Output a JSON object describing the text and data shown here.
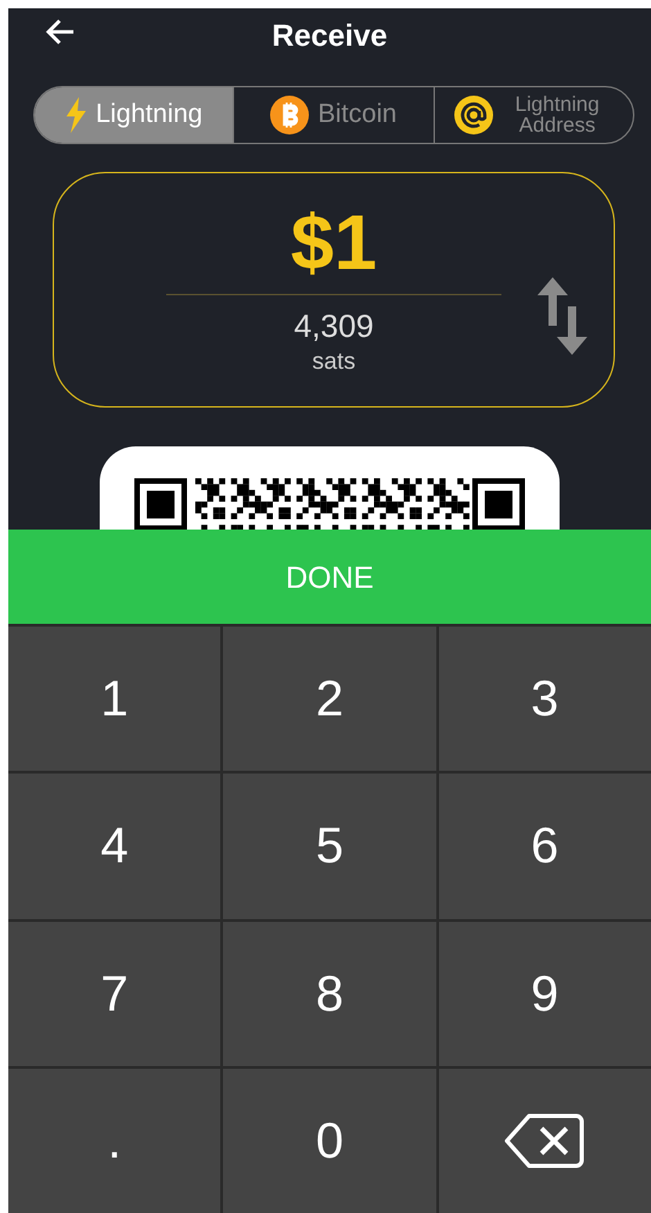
{
  "header": {
    "title": "Receive"
  },
  "tabs": [
    {
      "label": "Lightning",
      "kind": "bolt",
      "selected": true
    },
    {
      "label": "Bitcoin",
      "kind": "bitcoin",
      "selected": false
    },
    {
      "label": "Lightning Address",
      "kind": "at",
      "selected": false
    }
  ],
  "amount": {
    "primary": "$1",
    "secondary": "4,309",
    "unit": "sats"
  },
  "done_button": "DONE",
  "keypad": [
    {
      "kind": "digit",
      "label": "1"
    },
    {
      "kind": "digit",
      "label": "2"
    },
    {
      "kind": "digit",
      "label": "3"
    },
    {
      "kind": "digit",
      "label": "4"
    },
    {
      "kind": "digit",
      "label": "5"
    },
    {
      "kind": "digit",
      "label": "6"
    },
    {
      "kind": "digit",
      "label": "7"
    },
    {
      "kind": "digit",
      "label": "8"
    },
    {
      "kind": "digit",
      "label": "9"
    },
    {
      "kind": "digit",
      "label": "."
    },
    {
      "kind": "digit",
      "label": "0"
    },
    {
      "kind": "backspace"
    }
  ]
}
